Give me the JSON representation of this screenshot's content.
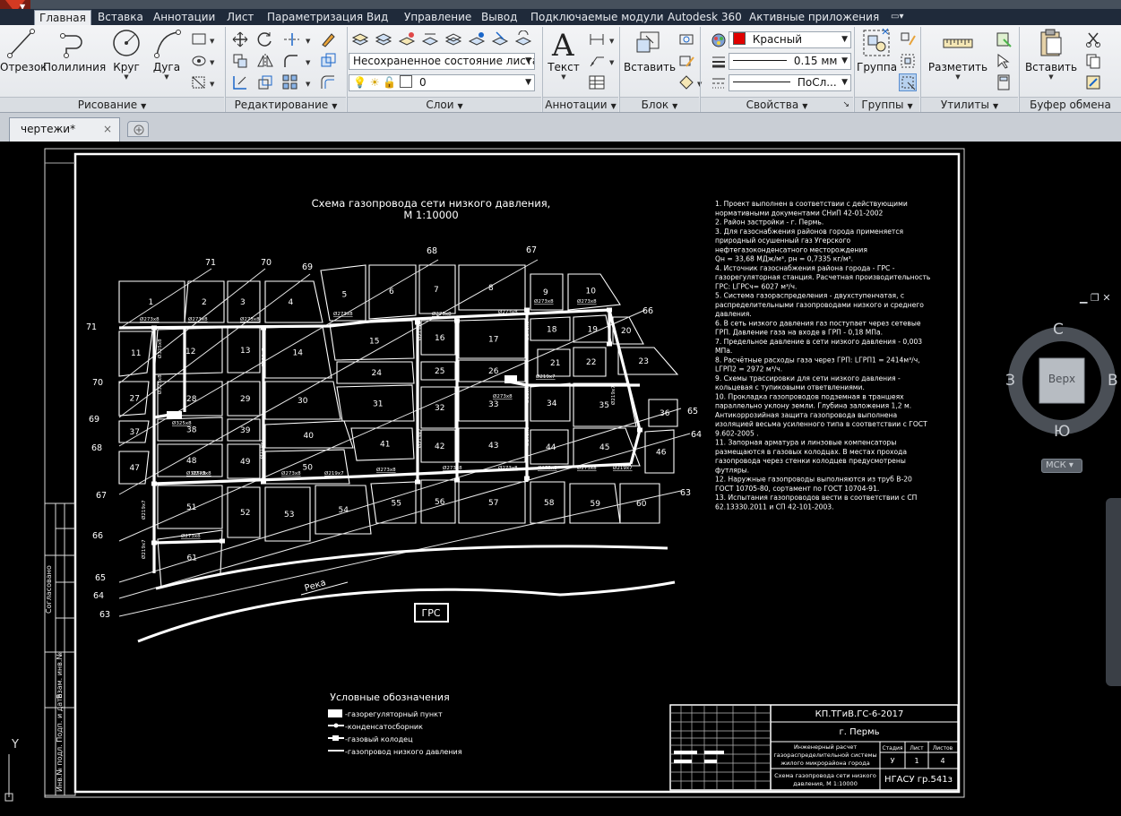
{
  "ribbon_tabs": [
    "Главная",
    "Вставка",
    "Аннотации",
    "Лист",
    "Параметризация",
    "Вид",
    "Управление",
    "Вывод",
    "Подключаемые модули",
    "Autodesk 360",
    "Активные приложения"
  ],
  "active_tab": "Главная",
  "panels": {
    "draw": {
      "title": "Рисование",
      "buttons": [
        "Отрезок",
        "Полилиния",
        "Круг",
        "Дуга"
      ]
    },
    "modify": {
      "title": "Редактирование"
    },
    "layers": {
      "title": "Слои",
      "state_combo": "Несохраненное состояние листа",
      "layer_combo": "0"
    },
    "annotations": {
      "title": "Аннотации",
      "text_button": "Текст"
    },
    "block": {
      "title": "Блок",
      "insert_button": "Вставить"
    },
    "properties": {
      "title": "Свойства",
      "color_value": "Красный",
      "color_hex": "#e00000",
      "lineweight_value": "0.15 мм",
      "linetype_value": "ПоСл..."
    },
    "groups": {
      "title": "Группы",
      "group_button": "Группа"
    },
    "utilities": {
      "title": "Утилиты",
      "measure_button": "Разметить"
    },
    "clipboard": {
      "title": "Буфер обмена",
      "paste_button": "Вставить"
    }
  },
  "document_tab": {
    "name": "чертежи*",
    "close": "×"
  },
  "viewcube": {
    "north": "С",
    "south": "Ю",
    "west": "З",
    "east": "В",
    "face": "Верх",
    "wcs": "МСК"
  },
  "drawing": {
    "title_line1": "Схема газопровода сети низкого давления,",
    "title_line2": "М 1:10000",
    "notes": [
      "1. Проект выполнен в соответствии с действующими",
      "нормативными документами СНиП 42-01-2002",
      "2. Район застройки - г. Пермь.",
      "3. Для газоснабжения районов города применяется",
      "природный осушенный газ Угерского",
      "нефтегазоконденсатного месторождения",
      "Qн = 33,68 МДж/м³,   рн = 0,7335 кг/м³.",
      " 4. Источник газоснабжения района города - ГРС -",
      "газорегуляторная станция. Расчетная производительность",
      "ГРС: LГРСч= 6027 м³/ч.",
      "5. Система газораспределения - двухступенчатая, с",
      "распределительными газопроводами низкого и среднего",
      "давления.",
      "6. В сеть низкого давления газ поступает через сетевые",
      "ГРП. Давление газа на входе в ГРП - 0,18 МПа.",
      "7. Предельное давление в сети низкого давления - 0,003",
      "МПа.",
      "8. Расчётные расходы газа через ГРП:  LГРП1 = 2414м³/ч,",
      "LГРП2 = 2972 м³/ч.",
      "9. Схемы трассировки для сети низкого давления -",
      "кольцевая с тупиковыми ответвлениями.",
      "10. Прокладка газопроводов подземная в траншеях",
      "параллельно уклону земли. Глубина заложения 1,2 м.",
      "Антикоррозийная защита газопровода выполнена",
      "изоляцией весьма усиленного типа в соответствии с ГОСТ",
      "9.602-2005 .",
      "11. Запорная  арматура и линзовые компенсаторы",
      "размещаются в газовых колодцах. В местах прохода",
      "газопровода через стенки колодцев  предусмотрены",
      "футляры.",
      "12. Наружные газопроводы выполняются из труб В-20",
      "ГОСТ 10705-80, сортамент по ГОСТ 10704-91.",
      "13. Испытания газопроводов вести  в соответствии с СП",
      "62.13330.2011 и СП 42-101-2003."
    ],
    "legend_title": "Условные обозначения",
    "legend": [
      "-газорегуляторный пункт",
      "-конденсатосборник",
      "-газовый колодец",
      "-газопровод низкого давления"
    ],
    "grs_label": "ГРС",
    "river_label": "Река",
    "title_block": {
      "code": "КП.ТГиВ.ГС-6-2017",
      "city": "г. Пермь",
      "project": [
        "Инженерный расчет",
        "газораспределительной системы",
        "жилого микрорайона города"
      ],
      "sheet_title": [
        "Схема газопровода сети низкого",
        "давления,  М 1:10000"
      ],
      "org": "НГАСУ  гр.541з",
      "stage_headers": [
        "Стадия",
        "Лист",
        "Листов"
      ],
      "stage_values": [
        "У",
        "1",
        "4"
      ]
    },
    "isoline_labels": [
      "71",
      "70",
      "69",
      "68",
      "67",
      "66",
      "65",
      "64",
      "63"
    ],
    "blocks": [
      "1",
      "2",
      "3",
      "4",
      "5",
      "6",
      "7",
      "8",
      "9",
      "10",
      "11",
      "12",
      "13",
      "14",
      "15",
      "16",
      "17",
      "18",
      "19",
      "20",
      "21",
      "22",
      "23",
      "24",
      "25",
      "26",
      "27",
      "28",
      "29",
      "30",
      "31",
      "32",
      "33",
      "34",
      "35",
      "36",
      "37",
      "38",
      "39",
      "40",
      "41",
      "42",
      "43",
      "44",
      "45",
      "46",
      "47",
      "48",
      "49",
      "50",
      "51",
      "52",
      "53",
      "54",
      "55",
      "56",
      "57",
      "58",
      "59",
      "60",
      "61"
    ],
    "pipe_labels": [
      "Ø273х8",
      "Ø219х7",
      "Ø325х8"
    ],
    "side_stamp": [
      "Инв.№ подл. Подп. и дата",
      "Взам. инв.№",
      "Согласовано"
    ],
    "ucs_y": "Y"
  }
}
